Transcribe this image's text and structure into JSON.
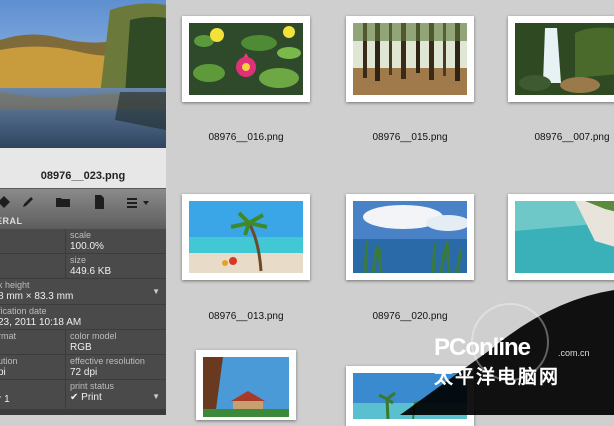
{
  "inspector": {
    "preview_filename": "08976__023.png",
    "section_title": "ERAL",
    "fields": {
      "scale_label": "scale",
      "scale_value": "100.0%",
      "size_label": "size",
      "size_value": "449.6 KB",
      "dimensions_label": "x height",
      "dimensions_value": "8 mm × 83.3 mm",
      "date_label": "fication date",
      "date_value": "23, 2011 10:18 AM",
      "format_label": "rmat",
      "color_model_label": "color model",
      "color_model_value": "RGB",
      "resolution_label": "ution",
      "resolution_value": "pi",
      "eff_resolution_label": "effective resolution",
      "eff_resolution_value": "72 dpi",
      "page_label": "r 1",
      "print_status_label": "print status",
      "print_status_value": "✔ Print"
    },
    "toolbar_icons": [
      "tag-icon",
      "folder-icon",
      "pencil-icon",
      "document-icon",
      "list-menu-icon"
    ]
  },
  "grid": {
    "items": [
      {
        "filename": "08976__016.png"
      },
      {
        "filename": "08976__015.png"
      },
      {
        "filename": "08976__007.png"
      },
      {
        "filename": "08976__013.png"
      },
      {
        "filename": "08976__020.png"
      },
      {
        "filename": ""
      },
      {
        "filename": ""
      },
      {
        "filename": ""
      }
    ]
  },
  "watermark": {
    "brand": "PConline",
    "domain": ".com.cn",
    "chinese": "太平洋电脑网"
  }
}
